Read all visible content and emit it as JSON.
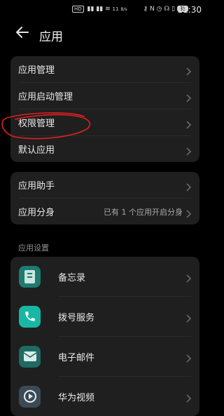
{
  "status_bar": {
    "network": "HD",
    "net_speed": "11",
    "net_unit": "B/s",
    "nfc": "N",
    "battery": "85",
    "time": "11:30"
  },
  "header": {
    "title": "应用"
  },
  "group1": {
    "items": [
      {
        "label": "应用管理"
      },
      {
        "label": "应用启动管理"
      },
      {
        "label": "权限管理"
      },
      {
        "label": "默认应用"
      }
    ]
  },
  "group2": {
    "items": [
      {
        "label": "应用助手"
      },
      {
        "label": "应用分身",
        "hint": "已有 1 个应用开启分身"
      }
    ]
  },
  "section_app_settings": {
    "title": "应用设置"
  },
  "apps": [
    {
      "label": "备忘录",
      "icon": "memo-icon",
      "color": "#1f7a70"
    },
    {
      "label": "拨号服务",
      "icon": "phone-icon",
      "color": "#18b7a5"
    },
    {
      "label": "电子邮件",
      "icon": "email-icon",
      "color": "#1f6a62"
    },
    {
      "label": "华为视频",
      "icon": "video-icon",
      "color": "#3b4a55"
    }
  ],
  "colors": {
    "background": "#000000",
    "card": "#1f1f1f",
    "annotation": "#e02020"
  }
}
